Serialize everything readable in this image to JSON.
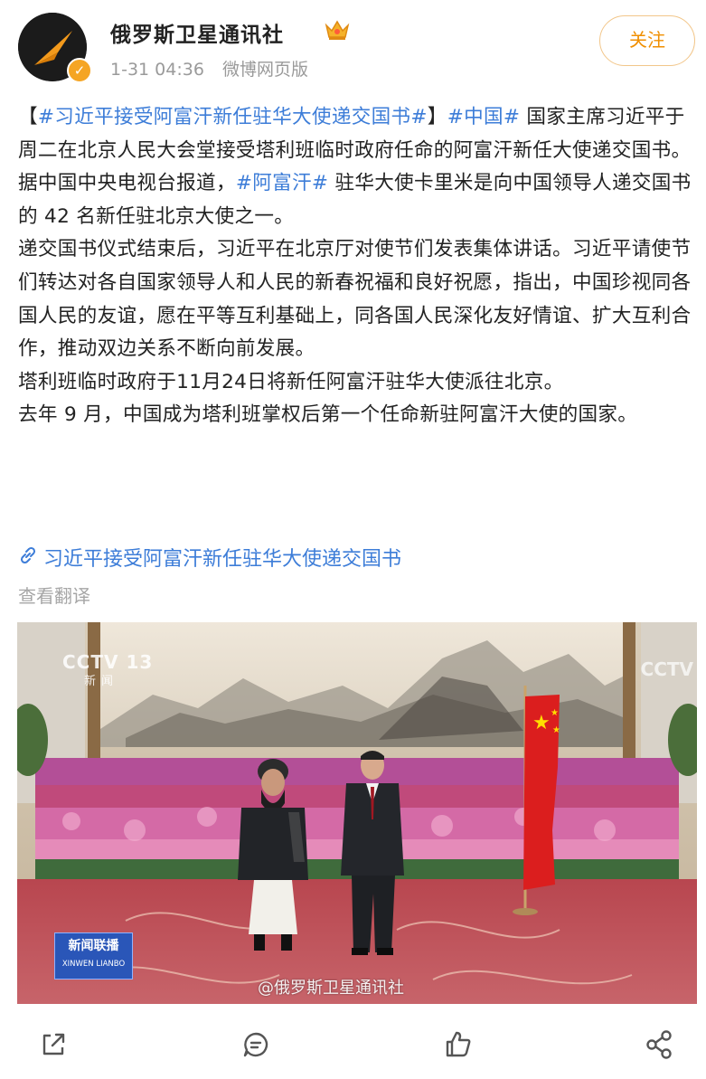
{
  "author": {
    "name": "俄罗斯卫星通讯社",
    "time": "1-31 04:36",
    "source": "微博网页版",
    "follow_label": "关注"
  },
  "post": {
    "paragraphs": [
      [
        {
          "text": "【",
          "tag": false
        },
        {
          "text": "#习近平接受阿富汗新任驻华大使递交国书#",
          "tag": true
        },
        {
          "text": "】",
          "tag": false
        },
        {
          "text": "#中国#",
          "tag": true
        },
        {
          "text": " 国家主席习近平于周二在北京人民大会堂接受塔利班临时政府任命的阿富汗新任大使递交国书。",
          "tag": false
        }
      ],
      [
        {
          "text": "据中国中央电视台报道，",
          "tag": false
        },
        {
          "text": "#阿富汗#",
          "tag": true
        },
        {
          "text": " 驻华大使卡里米是向中国领导人递交国书的 42 名新任驻北京大使之一。",
          "tag": false
        }
      ],
      [
        {
          "text": "递交国书仪式结束后，习近平在北京厅对使节们发表集体讲话。习近平请使节们转达对各自国家领导人和人民的新春祝福和良好祝愿，指出，中国珍视同各国人民的友谊，愿在平等互利基础上，同各国人民深化友好情谊、扩大互利合作，推动双边关系不断向前发展。",
          "tag": false
        }
      ],
      [
        {
          "text": "塔利班临时政府于11月24日将新任阿富汗驻华大使派往北京。",
          "tag": false
        }
      ],
      [
        {
          "text": "去年 9 月，中国成为塔利班掌权后第一个任命新驻阿富汗大使的国家。",
          "tag": false
        }
      ]
    ],
    "link_text": "习近平接受阿富汗新任驻华大使递交国书",
    "translate_label": "查看翻译"
  },
  "image": {
    "cctv_left": "CCTV 13",
    "cctv_left_sub": "新闻",
    "cctv_right": "CCTV",
    "news_logo_cn": "新闻联播",
    "news_logo_en": "XINWEN LIANBO",
    "watermark": "@俄罗斯卫星通讯社"
  },
  "actions": {
    "icons": [
      "share-icon",
      "comment-icon",
      "like-icon",
      "more-share-icon"
    ]
  },
  "colors": {
    "accent": "#f08f00",
    "link": "#3d7dd8",
    "meta": "#9a9a9a"
  }
}
